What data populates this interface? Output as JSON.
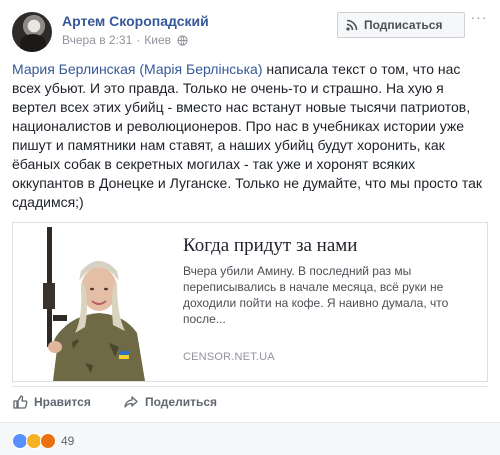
{
  "post": {
    "author": "Артем Скоропадский",
    "time": "Вчера в 2:31",
    "location": "Киев",
    "subscribe_label": "Подписаться",
    "mention": "Мария Берлинская (Марія Берлінська)",
    "text": " написала текст о том, что нас всех убьют. И это правда. Только не очень-то и страшно. На хую я вертел всех этих убийц - вместо нас встанут новые тысячи патриотов, националистов и революционеров. Про нас в учебниках истории уже пишут и памятники нам ставят, а наших убийц будут хоронить, как ёбаных собак в секретных могилах - так уже и хоронят всяких оккупантов в Донецке и Луганске. Только не думайте, что мы просто так сдадимся;)"
  },
  "preview": {
    "title": "Когда придут за нами",
    "description": "Вчера убили Амину. В последний раз мы переписывались в начале месяца, всё руки не доходили пойти на кофе. Я наивно думала, что после...",
    "domain": "CENSOR.NET.UA"
  },
  "actions": {
    "like_label": "Нравится",
    "share_label": "Поделиться"
  },
  "reactions": {
    "count": "49",
    "types": [
      "like",
      "sad",
      "angry"
    ]
  },
  "colors": {
    "link": "#365899",
    "text": "#1d2129",
    "muted": "#90949c",
    "like_blue": "#5890ff",
    "sad_yellow": "#f7b125",
    "angry_orange": "#e9710f"
  }
}
